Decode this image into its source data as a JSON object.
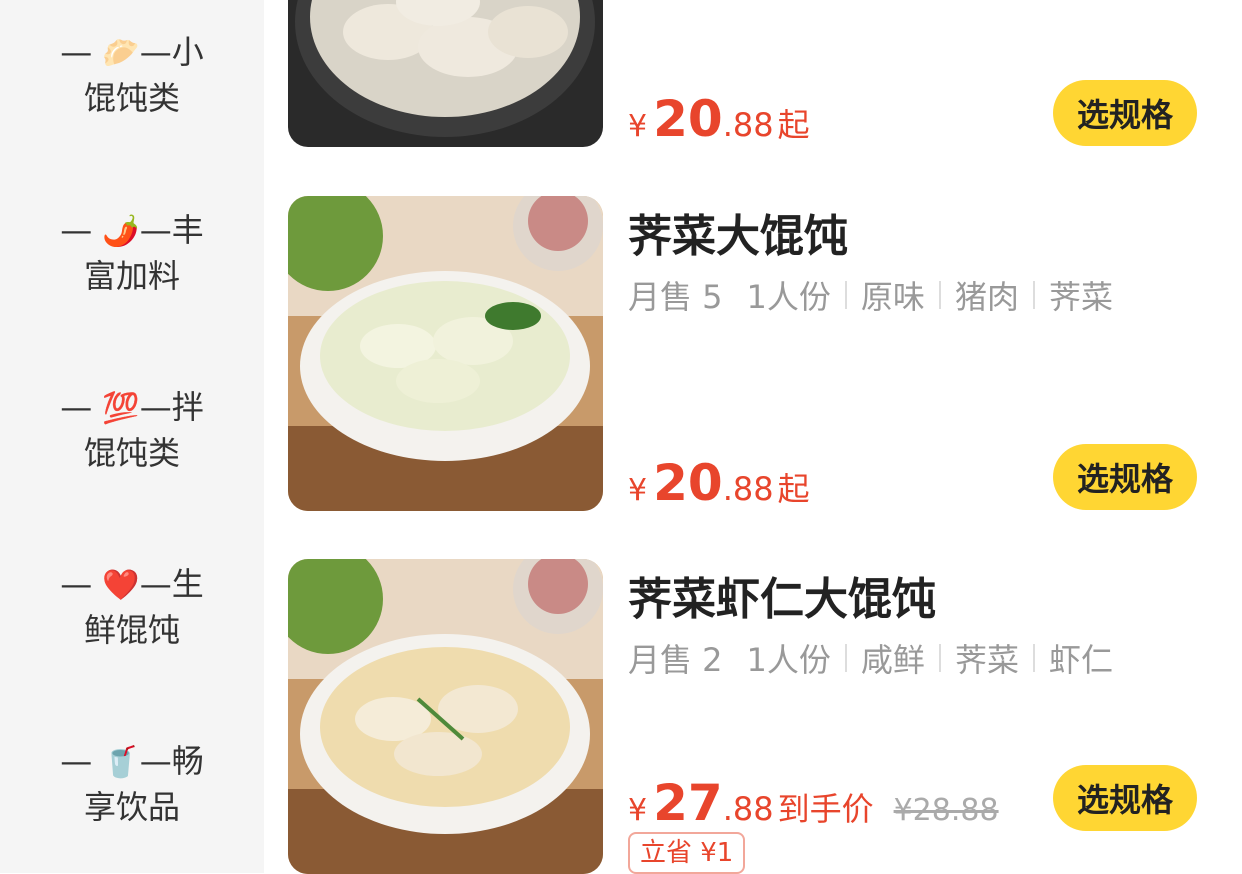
{
  "sidebar": {
    "categories": [
      {
        "line1": "—",
        "emoji": "🥟",
        "line1_after": "—小",
        "line2": "馄饨类",
        "icon": "dumpling-icon"
      },
      {
        "line1": "—",
        "emoji": "🌶️",
        "line1_after": "—丰",
        "line2": "富加料",
        "icon": "chili-icon"
      },
      {
        "line1": "—",
        "emoji": "💯",
        "line1_after": "—拌",
        "line2": "馄饨类",
        "icon": "hundred-icon"
      },
      {
        "line1": "—",
        "emoji": "❤️",
        "line1_after": "—生",
        "line2": "鲜馄饨",
        "icon": "heart-icon"
      },
      {
        "line1": "—",
        "emoji": "🥤",
        "line1_after": "—畅",
        "line2": "享饮品",
        "icon": "drink-icon"
      }
    ]
  },
  "items": [
    {
      "name": "",
      "price": {
        "yen": "¥",
        "int": "20",
        "dec": ".88",
        "suffix": "起"
      },
      "button": "选规格"
    },
    {
      "name": "荠菜大馄饨",
      "meta": [
        "月售 5",
        "1人份",
        "原味",
        "猪肉",
        "荠菜"
      ],
      "price": {
        "yen": "¥",
        "int": "20",
        "dec": ".88",
        "suffix": "起"
      },
      "button": "选规格"
    },
    {
      "name": "荠菜虾仁大馄饨",
      "meta": [
        "月售 2",
        "1人份",
        "咸鲜",
        "荠菜",
        "虾仁"
      ],
      "price": {
        "yen": "¥",
        "int": "27",
        "dec": ".88",
        "suffix": "到手价",
        "original": "¥28.88"
      },
      "save_tag": "立省 ¥1",
      "button": "选规格"
    }
  ],
  "colors": {
    "price": "#e8452c",
    "button": "#ffd633",
    "sidebar_bg": "#f5f5f5"
  }
}
